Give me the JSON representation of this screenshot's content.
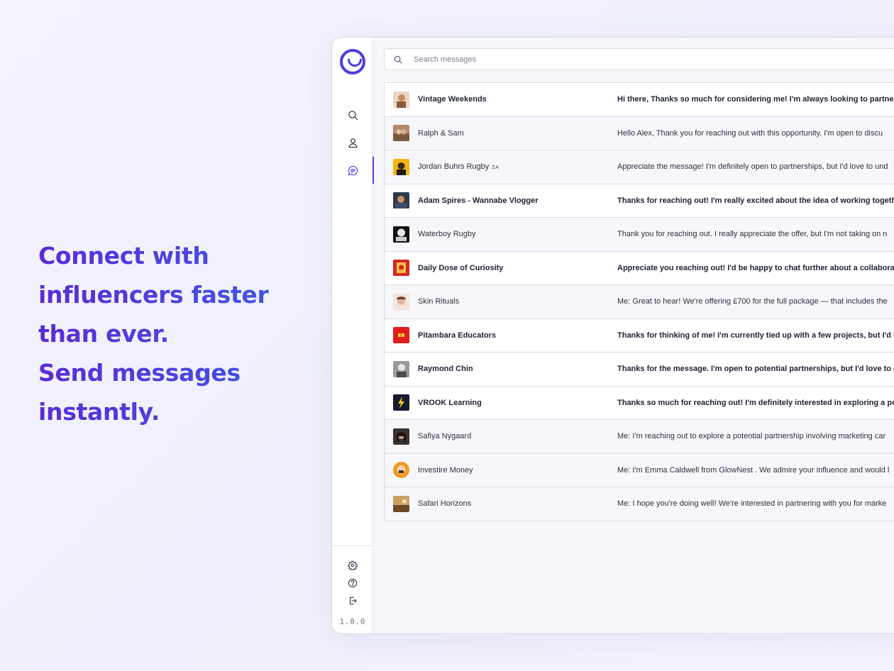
{
  "hero": {
    "lines": [
      "Connect with",
      "influencers faster",
      "than ever.",
      "Send messages",
      "instantly."
    ]
  },
  "sidebar": {
    "logo": "smile-logo",
    "nav": [
      {
        "icon": "search-icon",
        "active": false
      },
      {
        "icon": "user-icon",
        "active": false
      },
      {
        "icon": "chat-icon",
        "active": true
      }
    ],
    "footer": [
      {
        "icon": "gear-icon"
      },
      {
        "icon": "help-icon"
      },
      {
        "icon": "logout-icon"
      }
    ],
    "version": "1.0.0"
  },
  "search": {
    "placeholder": "Search messages",
    "icon": "search-icon"
  },
  "colors": {
    "accent": "#4b3ee0",
    "hero_start": "#5b2bd6",
    "hero_end": "#3f5ae6"
  },
  "messages": [
    {
      "name": "Vintage Weekends",
      "tag": "",
      "preview": "Hi there, Thanks so much for considering me! I'm always looking to partner w",
      "unread": true
    },
    {
      "name": "Ralph & Sam",
      "tag": "",
      "preview": "Hello Alex, Thank you for reaching out with this opportunity. I'm open to discu",
      "unread": false
    },
    {
      "name": "Jordan Buhrs Rugby",
      "tag": "ZA",
      "preview": "Appreciate the message! I'm definitely open to partnerships, but I'd love to und",
      "unread": false
    },
    {
      "name": "Adam Spires - Wannabe Vlogger",
      "tag": "",
      "preview": "Thanks for reaching out! I'm really excited about the idea of working togethe",
      "unread": true
    },
    {
      "name": "Waterboy Rugby",
      "tag": "",
      "preview": "Thank you for reaching out. I really appreciate the offer, but I'm not taking on n",
      "unread": false
    },
    {
      "name": "Daily Dose of Curiosity",
      "tag": "",
      "preview": "Appreciate you reaching out! I'd be happy to chat further about a collaboratio",
      "unread": true
    },
    {
      "name": "Skin Rituals",
      "tag": "",
      "preview": "Me: Great to hear! We're offering £700 for the full package — that includes the",
      "unread": false
    },
    {
      "name": "Pitambara Educators",
      "tag": "",
      "preview": "Thanks for thinking of me! I'm currently tied up with a few projects, but I'd lo",
      "unread": true
    },
    {
      "name": "Raymond Chin",
      "tag": "",
      "preview": "Thanks for the message. I'm open to potential partnerships, but I'd love to ge",
      "unread": true
    },
    {
      "name": "VROOK Learning",
      "tag": "",
      "preview": "Thanks so much for reaching out! I'm definitely interested in exploring a pote",
      "unread": true
    },
    {
      "name": "Safiya Nygaard",
      "tag": "",
      "preview": "Me: I'm reaching out to explore a potential partnership involving marketing car",
      "unread": false
    },
    {
      "name": "Investire Money",
      "tag": "",
      "preview": "Me: I'm Emma Caldwell from GlowNest . We admire your influence and would l",
      "unread": false
    },
    {
      "name": "Safari Horizons",
      "tag": "",
      "preview": "Me: I hope you're doing well! We're interested in partnering with you for marke",
      "unread": false
    }
  ]
}
